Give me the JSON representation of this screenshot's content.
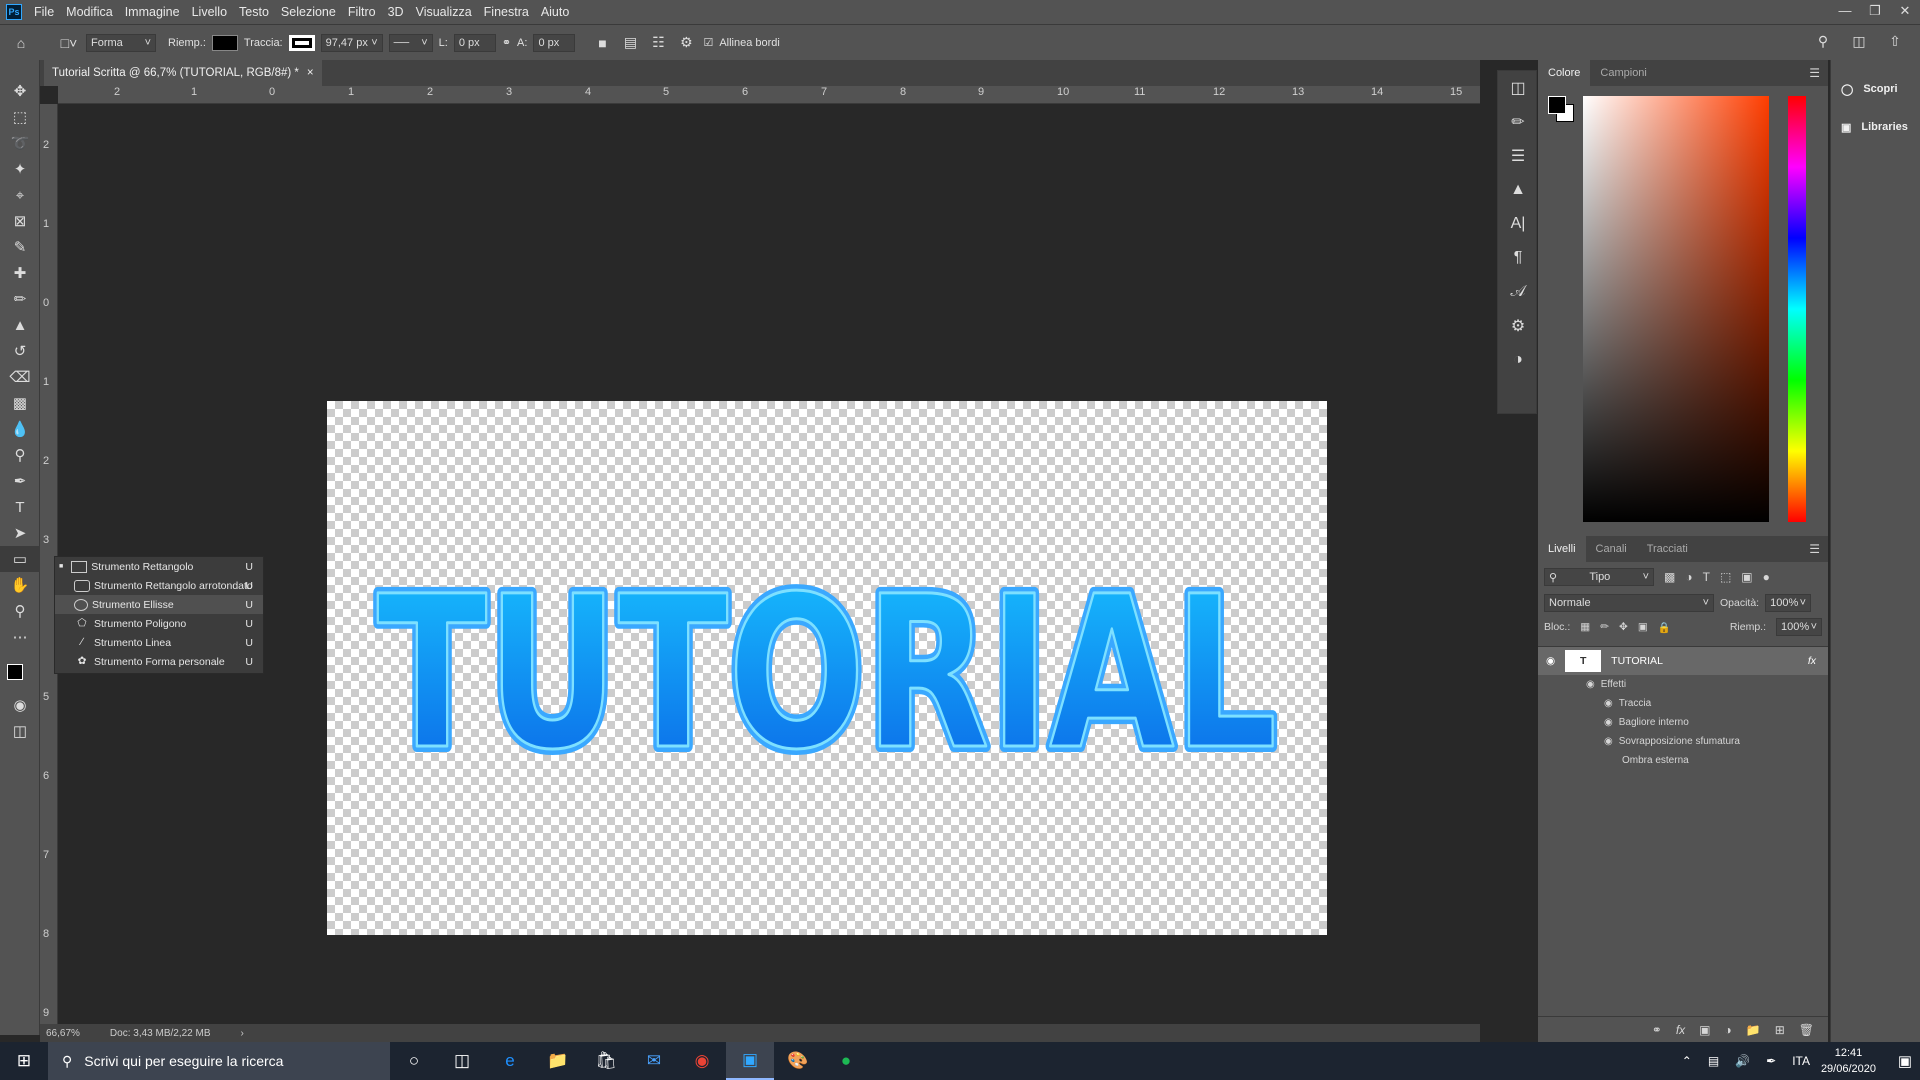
{
  "app": {
    "logo": "Ps"
  },
  "menu": [
    "File",
    "Modifica",
    "Immagine",
    "Livello",
    "Testo",
    "Selezione",
    "Filtro",
    "3D",
    "Visualizza",
    "Finestra",
    "Aiuto"
  ],
  "options": {
    "mode": "Forma",
    "fill_label": "Riemp.:",
    "stroke_label": "Traccia:",
    "stroke_width": "97,47 px",
    "w_label": "L:",
    "w_value": "0 px",
    "h_label": "A:",
    "h_value": "0 px",
    "align_edges": "Allinea bordi"
  },
  "document": {
    "tab_title": "Tutorial Scritta @ 66,7% (TUTORIAL, RGB/8#) *",
    "canvas_text": "TUTORIAL"
  },
  "ruler": {
    "h": [
      "2",
      "1",
      "0",
      "1",
      "2",
      "3",
      "4",
      "5",
      "6",
      "7",
      "8",
      "9",
      "10",
      "11",
      "12",
      "13",
      "14",
      "15"
    ],
    "v": [
      "2",
      "1",
      "0",
      "1",
      "2",
      "3",
      "4",
      "5",
      "6",
      "7",
      "8",
      "9"
    ]
  },
  "status": {
    "zoom": "66,67%",
    "doc": "Doc: 3,43 MB/2,22 MB"
  },
  "flyout": [
    {
      "label": "Strumento Rettangolo",
      "key": "U"
    },
    {
      "label": "Strumento Rettangolo arrotondato",
      "key": "U"
    },
    {
      "label": "Strumento Ellisse",
      "key": "U"
    },
    {
      "label": "Strumento Poligono",
      "key": "U"
    },
    {
      "label": "Strumento Linea",
      "key": "U"
    },
    {
      "label": "Strumento Forma personale",
      "key": "U"
    }
  ],
  "color_panel": {
    "tabs": [
      "Colore",
      "Campioni"
    ]
  },
  "layers_panel": {
    "tabs": [
      "Livelli",
      "Canali",
      "Tracciati"
    ],
    "filter": "Tipo",
    "blend": "Normale",
    "opacity_label": "Opacità:",
    "opacity": "100%",
    "lock_label": "Bloc.:",
    "fill_label": "Riemp.:",
    "fill": "100%",
    "layer_name": "TUTORIAL",
    "effects_label": "Effetti",
    "effects": [
      "Traccia",
      "Bagliore interno",
      "Sovrapposizione sfumatura",
      "Ombra esterna"
    ]
  },
  "learn": [
    "Scopri",
    "Libraries"
  ],
  "taskbar": {
    "search_placeholder": "Scrivi qui per eseguire la ricerca",
    "lang": "ITA",
    "time": "12:41",
    "date": "29/06/2020"
  }
}
